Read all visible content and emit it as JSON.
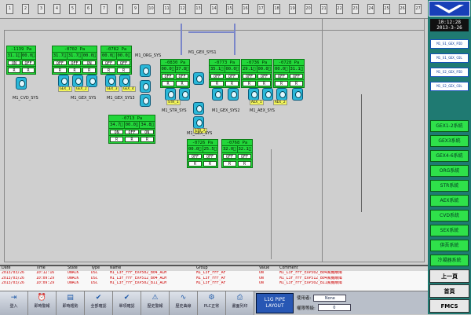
{
  "ruler": {
    "ticks": [
      "1",
      "2",
      "3",
      "4",
      "5",
      "6",
      "7",
      "8",
      "9",
      "10",
      "11",
      "12",
      "13",
      "14",
      "15",
      "16",
      "17",
      "18",
      "19",
      "20",
      "21",
      "22",
      "23",
      "24",
      "25",
      "26",
      "27"
    ]
  },
  "panels": [
    {
      "id": "1139",
      "title": "-1139 Pa",
      "values": [
        "31.1ﾟC",
        "00.0ﾟC"
      ],
      "status": [
        "ON",
        "OFF"
      ],
      "flags": [
        "R",
        "R"
      ]
    },
    {
      "id": "0702",
      "title": "-0702 Pa",
      "values": [
        "31.7ﾟC",
        "31.7ﾟC",
        "00.0ﾟC"
      ],
      "status": [
        "OFF",
        "OFF",
        "ON"
      ],
      "flags": [
        "R",
        "R",
        "R"
      ]
    },
    {
      "id": "0782",
      "title": "-0782 Pa",
      "values": [
        "00.0ﾟC",
        "00.0ﾟC"
      ],
      "status": [
        "OFF",
        "OFF"
      ],
      "flags": [
        "R",
        "R"
      ]
    },
    {
      "id": "0830",
      "title": "-0830 Pa",
      "values": [
        "00.0ﾟC",
        "37.8ﾟC"
      ],
      "status": [
        "OFF",
        "OFF"
      ],
      "flags": [
        "R",
        "R"
      ]
    },
    {
      "id": "0773",
      "title": "-0773 Pa",
      "values": [
        "35.1ﾟC",
        "00.0ﾟC"
      ],
      "status": [
        "OFF",
        "OFF"
      ],
      "flags": [
        "R",
        "R"
      ]
    },
    {
      "id": "0736",
      "title": "-0736 Pa",
      "values": [
        "29.1ﾟC",
        "00.0ﾟC"
      ],
      "status": [
        "OFF",
        "OFF"
      ],
      "flags": [
        "R",
        "R"
      ]
    },
    {
      "id": "0728",
      "title": "-0728 Pa",
      "values": [
        "00.0ﾟC",
        "31.1ﾟC"
      ],
      "status": [
        "OFF",
        "OFF"
      ],
      "flags": [
        "R",
        "R"
      ]
    },
    {
      "id": "0713",
      "title": "-0713 Pa",
      "values": [
        "34.7ﾟC",
        "00.0ﾟC",
        "34.8ﾟC"
      ],
      "status": [
        "ON",
        "OFF",
        "ON"
      ],
      "flags": [
        "R",
        "R",
        "R"
      ]
    },
    {
      "id": "0726",
      "title": "-0726 Pa",
      "values": [
        "00.0ﾟC",
        "25.5ﾟC"
      ],
      "status": [
        "OFF",
        "OFF"
      ],
      "flags": [
        "R",
        "R"
      ]
    },
    {
      "id": "0768",
      "title": "-0768 Pa",
      "values": [
        "32.0ﾟC",
        "32.1ﾟC"
      ],
      "status": [
        "OFF",
        "OFF"
      ],
      "flags": [
        "R",
        "R"
      ]
    }
  ],
  "systems": {
    "cvd": "M1_CVD_SYS",
    "gex1": "M1_GEX_SYS",
    "gex3": "M1_GEX_SYS3",
    "org": "M1_ORG_SYS",
    "str": "M1_STR_SYS",
    "gex1b": "M1_GEX_SYS1",
    "aex": "M1_AEX_SYS",
    "gex2": "M1_GEX_SYS2",
    "gex4": "M1_GEX_SYS"
  },
  "tags": {
    "t1": "GEX_1",
    "t2": "GEX_2",
    "t3": "GEX_3",
    "t4": "GEX_4",
    "t5": "AEX_1",
    "t6": "AEX_2",
    "t7": "STR_1",
    "t8": "STR_2"
  },
  "alarm": {
    "headers": [
      "Date",
      "Time",
      "State",
      "Type",
      "Name",
      "Group",
      "Value",
      "Comment"
    ],
    "rows": [
      [
        "2013/03/26",
        "10:12:16",
        "UNACK",
        "DSC",
        "M1_L3F_FFF_EXP502_B04_ALM",
        "M1_L3F_FFF_AF",
        "ON",
        "M1_L3F_FFF_EXP502_B04風機故障"
      ],
      [
        "2013/03/26",
        "10:09:29",
        "UNACK",
        "DSC",
        "M1_L3F_FFF_EXP512_B04_ALM",
        "M1_L3F_FFF_AF",
        "ON",
        "M1_L3F_FFF_EXP512_B04風機故障"
      ],
      [
        "2013/03/26",
        "10:09:29",
        "UNACK",
        "DSC",
        "M1_L3F_FFF_EXP502_B11_ALM",
        "M1_L3F_FFF_AF",
        "ON",
        "M1_L3F_FFF_EXP502_B11風機故障"
      ]
    ]
  },
  "toolbar": {
    "buttons": [
      "登入",
      "即時警報",
      "即時趨勢",
      "全部確認",
      "單項確認",
      "歷史警報",
      "歷史曲線",
      "PLC正常",
      "畫面列印"
    ],
    "layout_label": "L1G PIPE LAYOUT",
    "user_label": "使用者:",
    "user_value": "None",
    "level_label": "權限等級:",
    "level_value": "0"
  },
  "side": {
    "time": "10:12:28",
    "date": "2013-3-26",
    "menu": [
      "M1_S1_GEX_PID",
      "M1_S1_GEX_COL",
      "M1_S2_GEX_PID",
      "M1_S2_GEX_COL"
    ],
    "systems": [
      "GEX1-2系統",
      "GEX3系統",
      "GEX4-6系統",
      "ORG系統",
      "STR系統",
      "AEX系統",
      "CVD系統",
      "SEX系統",
      "供吾系統",
      "冷凝器系統"
    ],
    "nav": [
      "上一頁",
      "首頁",
      "FMCS"
    ]
  }
}
